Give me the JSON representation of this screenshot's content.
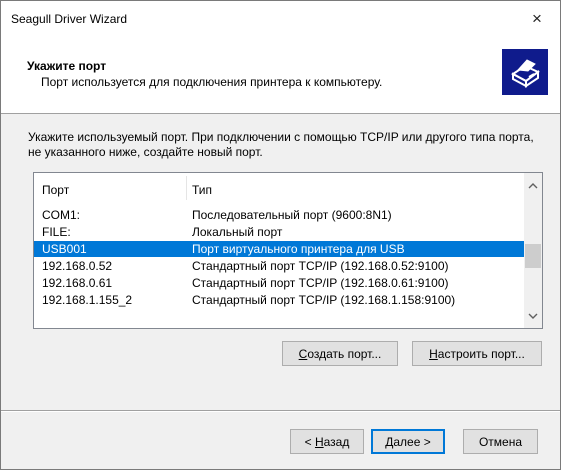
{
  "window": {
    "title": "Seagull Driver Wizard",
    "close_glyph": "×"
  },
  "header": {
    "title": "Укажите порт",
    "subtitle": "Порт используется для подключения принтера к компьютеру.",
    "logo_icon": "printer-icon"
  },
  "instruction": "Укажите используемый порт. При подключении с помощью TCP/IP или другого типа порта, не указанного ниже, создайте новый порт.",
  "port_list": {
    "columns": [
      "Порт",
      "Тип"
    ],
    "rows": [
      {
        "port": "COM1:",
        "type": "Последовательный порт (9600:8N1)",
        "selected": false
      },
      {
        "port": "FILE:",
        "type": "Локальный порт",
        "selected": false
      },
      {
        "port": "USB001",
        "type": "Порт виртуального принтера для USB",
        "selected": true
      },
      {
        "port": "192.168.0.52",
        "type": "Стандартный порт TCP/IP (192.168.0.52:9100)",
        "selected": false
      },
      {
        "port": "192.168.0.61",
        "type": "Стандартный порт TCP/IP (192.168.0.61:9100)",
        "selected": false
      },
      {
        "port": "192.168.1.155_2",
        "type": "Стандартный порт TCP/IP (192.168.1.158:9100)",
        "selected": false
      }
    ]
  },
  "buttons": {
    "create_port": {
      "mnemonic": "С",
      "rest": "оздать порт..."
    },
    "configure_port": {
      "mnemonic": "Н",
      "rest": "астроить порт..."
    },
    "back": {
      "prefix": "< ",
      "mnemonic": "Н",
      "rest": "азад"
    },
    "next": {
      "mnemonic": "Д",
      "rest": "алее >"
    },
    "cancel": "Отмена"
  },
  "colors": {
    "selection": "#0078d7",
    "logo_bg": "#0f1b8c"
  }
}
